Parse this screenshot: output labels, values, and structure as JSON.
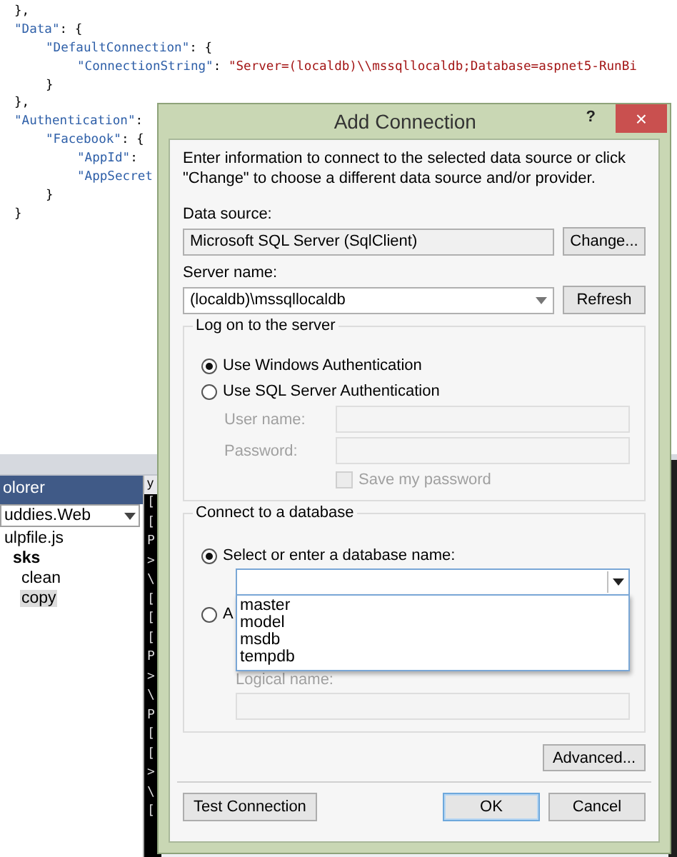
{
  "editor": {
    "lines": [
      {
        "tokens": [
          {
            "kind": "punct",
            "text": "},"
          }
        ]
      },
      {
        "tokens": [
          {
            "kind": "key",
            "text": "\"Data\""
          },
          {
            "kind": "punct",
            "text": ": {"
          }
        ],
        "children": [
          {
            "tokens": [
              {
                "kind": "key",
                "text": "\"DefaultConnection\""
              },
              {
                "kind": "punct",
                "text": ": {"
              }
            ],
            "children": [
              {
                "tokens": [
                  {
                    "kind": "key",
                    "text": "\"ConnectionString\""
                  },
                  {
                    "kind": "punct",
                    "text": ": "
                  },
                  {
                    "kind": "string",
                    "text": "\"Server=(localdb)\\\\mssqllocaldb;Database=aspnet5-RunBi"
                  }
                ]
              }
            ]
          },
          {
            "tokens": [
              {
                "kind": "punct",
                "text": "}"
              }
            ]
          }
        ]
      },
      {
        "tokens": [
          {
            "kind": "punct",
            "text": "},"
          }
        ]
      },
      {
        "tokens": [
          {
            "kind": "key",
            "text": "\"Authentication\""
          },
          {
            "kind": "punct",
            "text": ":"
          }
        ],
        "children": [
          {
            "tokens": [
              {
                "kind": "key",
                "text": "\"Facebook\""
              },
              {
                "kind": "punct",
                "text": ": {"
              }
            ],
            "children": [
              {
                "tokens": [
                  {
                    "kind": "key",
                    "text": "\"AppId\""
                  },
                  {
                    "kind": "punct",
                    "text": ":"
                  }
                ]
              },
              {
                "tokens": [
                  {
                    "kind": "key",
                    "text": "\"AppSecret"
                  }
                ]
              }
            ]
          },
          {
            "tokens": [
              {
                "kind": "punct",
                "text": "}"
              }
            ]
          }
        ]
      },
      {
        "tokens": [
          {
            "kind": "punct",
            "text": "}"
          }
        ]
      }
    ]
  },
  "explorer": {
    "title": "olorer",
    "project": "uddies.Web",
    "tree": [
      {
        "label": "ulpfile.js",
        "bold": false,
        "selected": false,
        "children": [
          {
            "label": "sks",
            "bold": true,
            "selected": false,
            "children": [
              {
                "label": "clean",
                "bold": false,
                "selected": false
              },
              {
                "label": "copy",
                "bold": false,
                "selected": true
              }
            ]
          }
        ]
      }
    ]
  },
  "output": {
    "header": "y",
    "lines": [
      "[",
      "[",
      "P",
      ">",
      "\\",
      "[",
      "[",
      "[",
      "P",
      ">",
      "\\",
      "P",
      "[",
      "[",
      ">",
      "\\",
      "["
    ]
  },
  "dialog": {
    "title": "Add Connection",
    "help": "?",
    "close": "×",
    "description": "Enter information to connect to the selected data source or click \"Change\" to choose a different data source and/or provider.",
    "data_source": {
      "label": "Data source:",
      "value": "Microsoft SQL Server (SqlClient)",
      "button": "Change..."
    },
    "server_name": {
      "label": "Server name:",
      "value": "(localdb)\\mssqllocaldb",
      "button": "Refresh"
    },
    "logon": {
      "title": "Log on to the server",
      "options": [
        {
          "label": "Use Windows Authentication",
          "selected": true
        },
        {
          "label": "Use SQL Server Authentication",
          "selected": false
        }
      ],
      "fields": [
        {
          "label": "User name:",
          "disabled": true
        },
        {
          "label": "Password:",
          "disabled": true
        }
      ],
      "save_password": {
        "label": "Save my password",
        "checked": false,
        "disabled": true
      }
    },
    "database": {
      "title": "Connect to a database",
      "options": [
        {
          "label": "Select or enter a database name:",
          "selected": true
        },
        {
          "label": "A",
          "selected": false
        }
      ],
      "dropdown": {
        "expanded": true,
        "items": [
          "master",
          "model",
          "msdb",
          "tempdb"
        ]
      },
      "logical_name": {
        "label": "Logical name:",
        "disabled": true
      }
    },
    "advanced": "Advanced...",
    "footer": [
      {
        "label": "Test Connection",
        "default": false
      },
      {
        "label": "OK",
        "default": true
      },
      {
        "label": "Cancel",
        "default": false
      }
    ]
  }
}
